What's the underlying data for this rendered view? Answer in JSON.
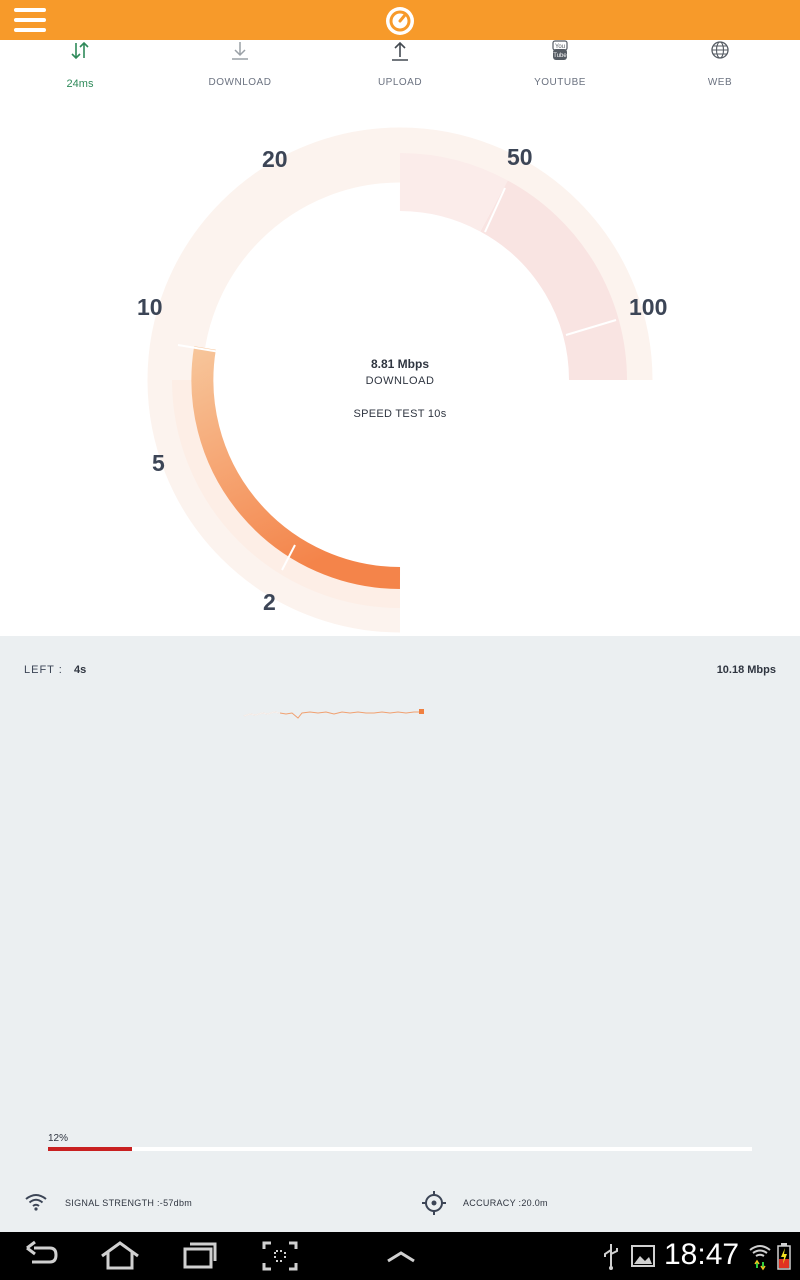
{
  "app": {
    "brand_color": "#f79a2a"
  },
  "tabs": [
    {
      "label": "24ms",
      "icon": "ping-arrows-icon",
      "active": true
    },
    {
      "label": "DOWNLOAD",
      "icon": "download-icon",
      "active": false
    },
    {
      "label": "UPLOAD",
      "icon": "upload-icon",
      "active": false
    },
    {
      "label": "YOUTUBE",
      "icon": "youtube-icon",
      "active": false
    },
    {
      "label": "WEB",
      "icon": "globe-icon",
      "active": false
    }
  ],
  "gauge": {
    "scale_labels": [
      "2",
      "5",
      "10",
      "20",
      "50",
      "100"
    ],
    "speed": "8.81 Mbps",
    "mode": "DOWNLOAD",
    "test_label": "SPEED TEST 10s",
    "fill_color": "#f4894a"
  },
  "panel": {
    "left_label": "LEFT :",
    "left_value": "4s",
    "max_speed": "10.18 Mbps",
    "progress_label": "12%",
    "progress": 0.12,
    "signal": "SIGNAL STRENGTH :-57dbm",
    "accuracy": "ACCURACY :20.0m"
  },
  "statusbar": {
    "time": "18:47"
  }
}
